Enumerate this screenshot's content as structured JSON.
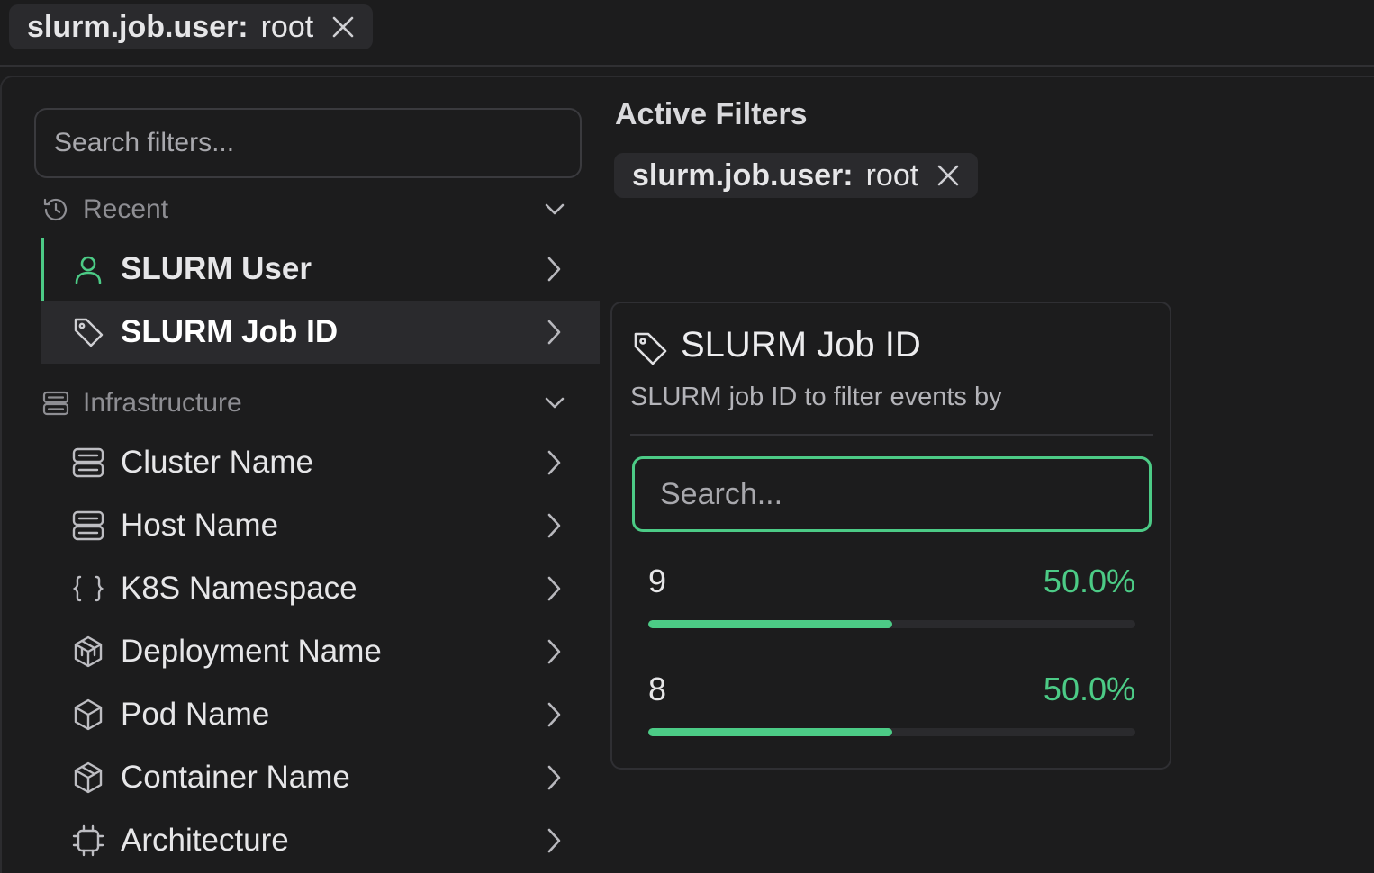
{
  "top_filter": {
    "key": "slurm.job.user:",
    "value": "root",
    "remove_icon": "close-icon"
  },
  "sidebar": {
    "search": {
      "placeholder": "Search filters..."
    },
    "groups": [
      {
        "title": "Recent",
        "icon": "clock-history-icon",
        "expanded": true,
        "items": [
          {
            "label": "SLURM User",
            "icon": "user-icon"
          },
          {
            "label": "SLURM Job ID",
            "icon": "tag-icon",
            "active": true
          }
        ]
      },
      {
        "title": "Infrastructure",
        "icon": "server-icon",
        "expanded": true,
        "items": [
          {
            "label": "Cluster Name",
            "icon": "server-icon"
          },
          {
            "label": "Host Name",
            "icon": "server-icon"
          },
          {
            "label": "K8S Namespace",
            "icon": "braces-icon"
          },
          {
            "label": "Deployment Name",
            "icon": "boxes-icon"
          },
          {
            "label": "Pod Name",
            "icon": "box-icon"
          },
          {
            "label": "Container Name",
            "icon": "container-icon"
          },
          {
            "label": "Architecture",
            "icon": "cpu-icon"
          }
        ]
      }
    ]
  },
  "active_filters": {
    "title": "Active Filters",
    "chips": [
      {
        "key": "slurm.job.user:",
        "value": "root"
      }
    ]
  },
  "popover": {
    "title": "SLURM Job ID",
    "description": "SLURM job ID to filter events by",
    "search_placeholder": "Search...",
    "values": [
      {
        "value": "9",
        "percent_label": "50.0%",
        "fraction": 0.5
      },
      {
        "value": "8",
        "percent_label": "50.0%",
        "fraction": 0.5
      }
    ]
  },
  "colors": {
    "accent": "#4ccb86",
    "background": "#1c1c1d",
    "chip": "#2a2a2d"
  }
}
